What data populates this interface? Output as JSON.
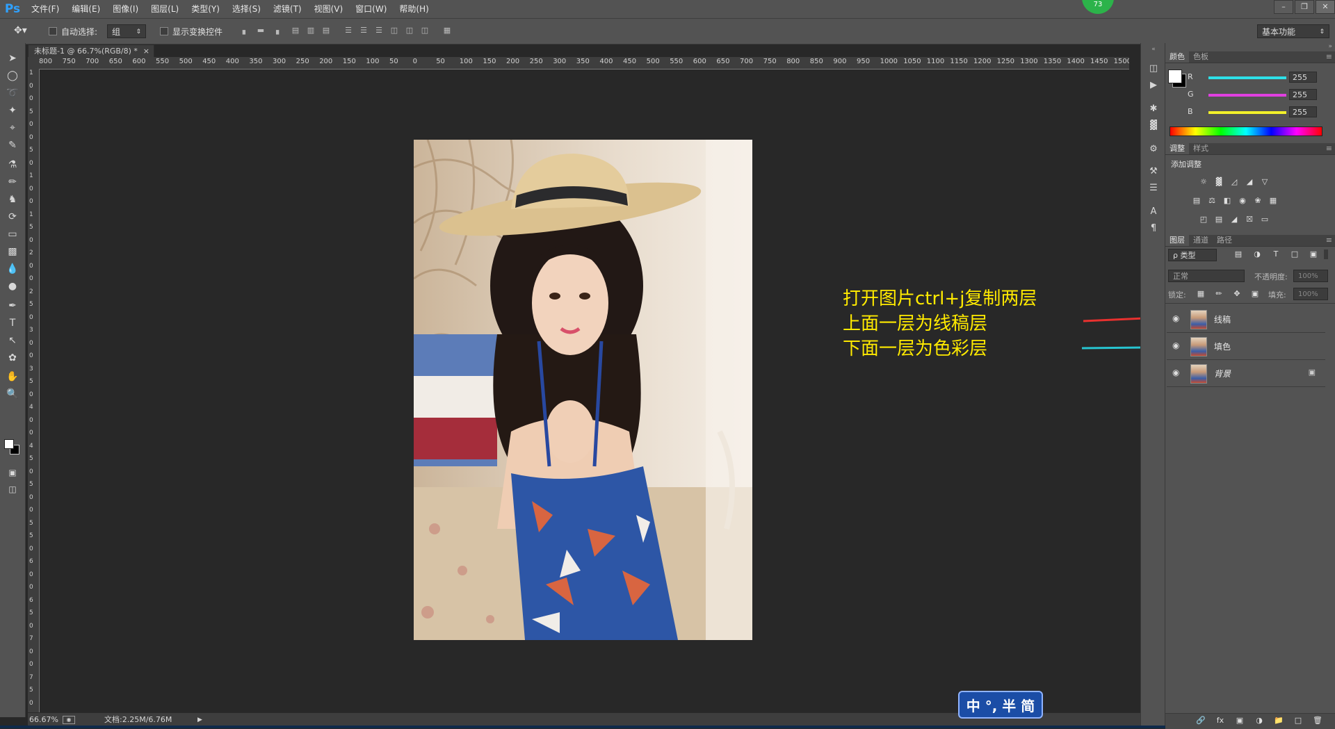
{
  "app": {
    "logo": "Ps",
    "badge": "73"
  },
  "menu": [
    "文件(F)",
    "编辑(E)",
    "图像(I)",
    "图层(L)",
    "类型(Y)",
    "选择(S)",
    "滤镜(T)",
    "视图(V)",
    "窗口(W)",
    "帮助(H)"
  ],
  "options": {
    "auto_select_label": "自动选择:",
    "auto_select_value": "组",
    "show_transform_label": "显示变换控件",
    "workspace": "基本功能"
  },
  "document": {
    "tab_title": "未标题-1 @ 66.7%(RGB/8) *",
    "ruler_top": [
      "800",
      "750",
      "700",
      "650",
      "600",
      "550",
      "500",
      "450",
      "400",
      "350",
      "300",
      "250",
      "200",
      "150",
      "100",
      "50",
      "0",
      "50",
      "100",
      "150",
      "200",
      "250",
      "300",
      "350",
      "400",
      "450",
      "500",
      "550",
      "600",
      "650",
      "700",
      "750",
      "800",
      "850",
      "900",
      "950",
      "1000",
      "1050",
      "1100",
      "1150",
      "1200",
      "1250",
      "1300",
      "1350",
      "1400",
      "1450",
      "1500"
    ],
    "ruler_left": [
      "1",
      "0",
      "0",
      "5",
      "0",
      "0",
      "5",
      "0",
      "1",
      "0",
      "0",
      "1",
      "5",
      "0",
      "2",
      "0",
      "0",
      "2",
      "5",
      "0",
      "3",
      "0",
      "0",
      "3",
      "5",
      "0",
      "4",
      "0",
      "0",
      "4",
      "5",
      "0",
      "5",
      "0",
      "0",
      "5",
      "5",
      "0",
      "6",
      "0",
      "0",
      "6",
      "5",
      "0",
      "7",
      "0",
      "0",
      "7",
      "5",
      "0"
    ]
  },
  "annotation": {
    "line1": "打开图片ctrl+j复制两层",
    "line2": "上面一层为线稿层",
    "line3": "下面一层为色彩层",
    "arrow_red": "#e8312f",
    "arrow_cyan": "#27c4d0"
  },
  "status": {
    "zoom": "66.67%",
    "doc": "文档:2.25M/6.76M"
  },
  "ime": {
    "label": "中 °, 半 简"
  },
  "color_panel": {
    "tabs": [
      "颜色",
      "色板"
    ],
    "channels": [
      {
        "label": "R",
        "value": "255",
        "color": "#2ee0e8"
      },
      {
        "label": "G",
        "value": "255",
        "color": "#e040e0"
      },
      {
        "label": "B",
        "value": "255",
        "color": "#f2f02a"
      }
    ]
  },
  "adjust_panel": {
    "tabs": [
      "调整",
      "样式"
    ],
    "title": "添加调整"
  },
  "layers_panel": {
    "tabs": [
      "图层",
      "通道",
      "路径"
    ],
    "filter": "ρ 类型",
    "blend": "正常",
    "opacity_label": "不透明度:",
    "opacity_value": "100%",
    "lock_label": "锁定:",
    "fill_label": "填充:",
    "fill_value": "100%",
    "layers": [
      {
        "name": "线稿",
        "selected": false
      },
      {
        "name": "填色",
        "selected": false
      },
      {
        "name": "背景",
        "selected": false,
        "locked": true
      }
    ]
  }
}
